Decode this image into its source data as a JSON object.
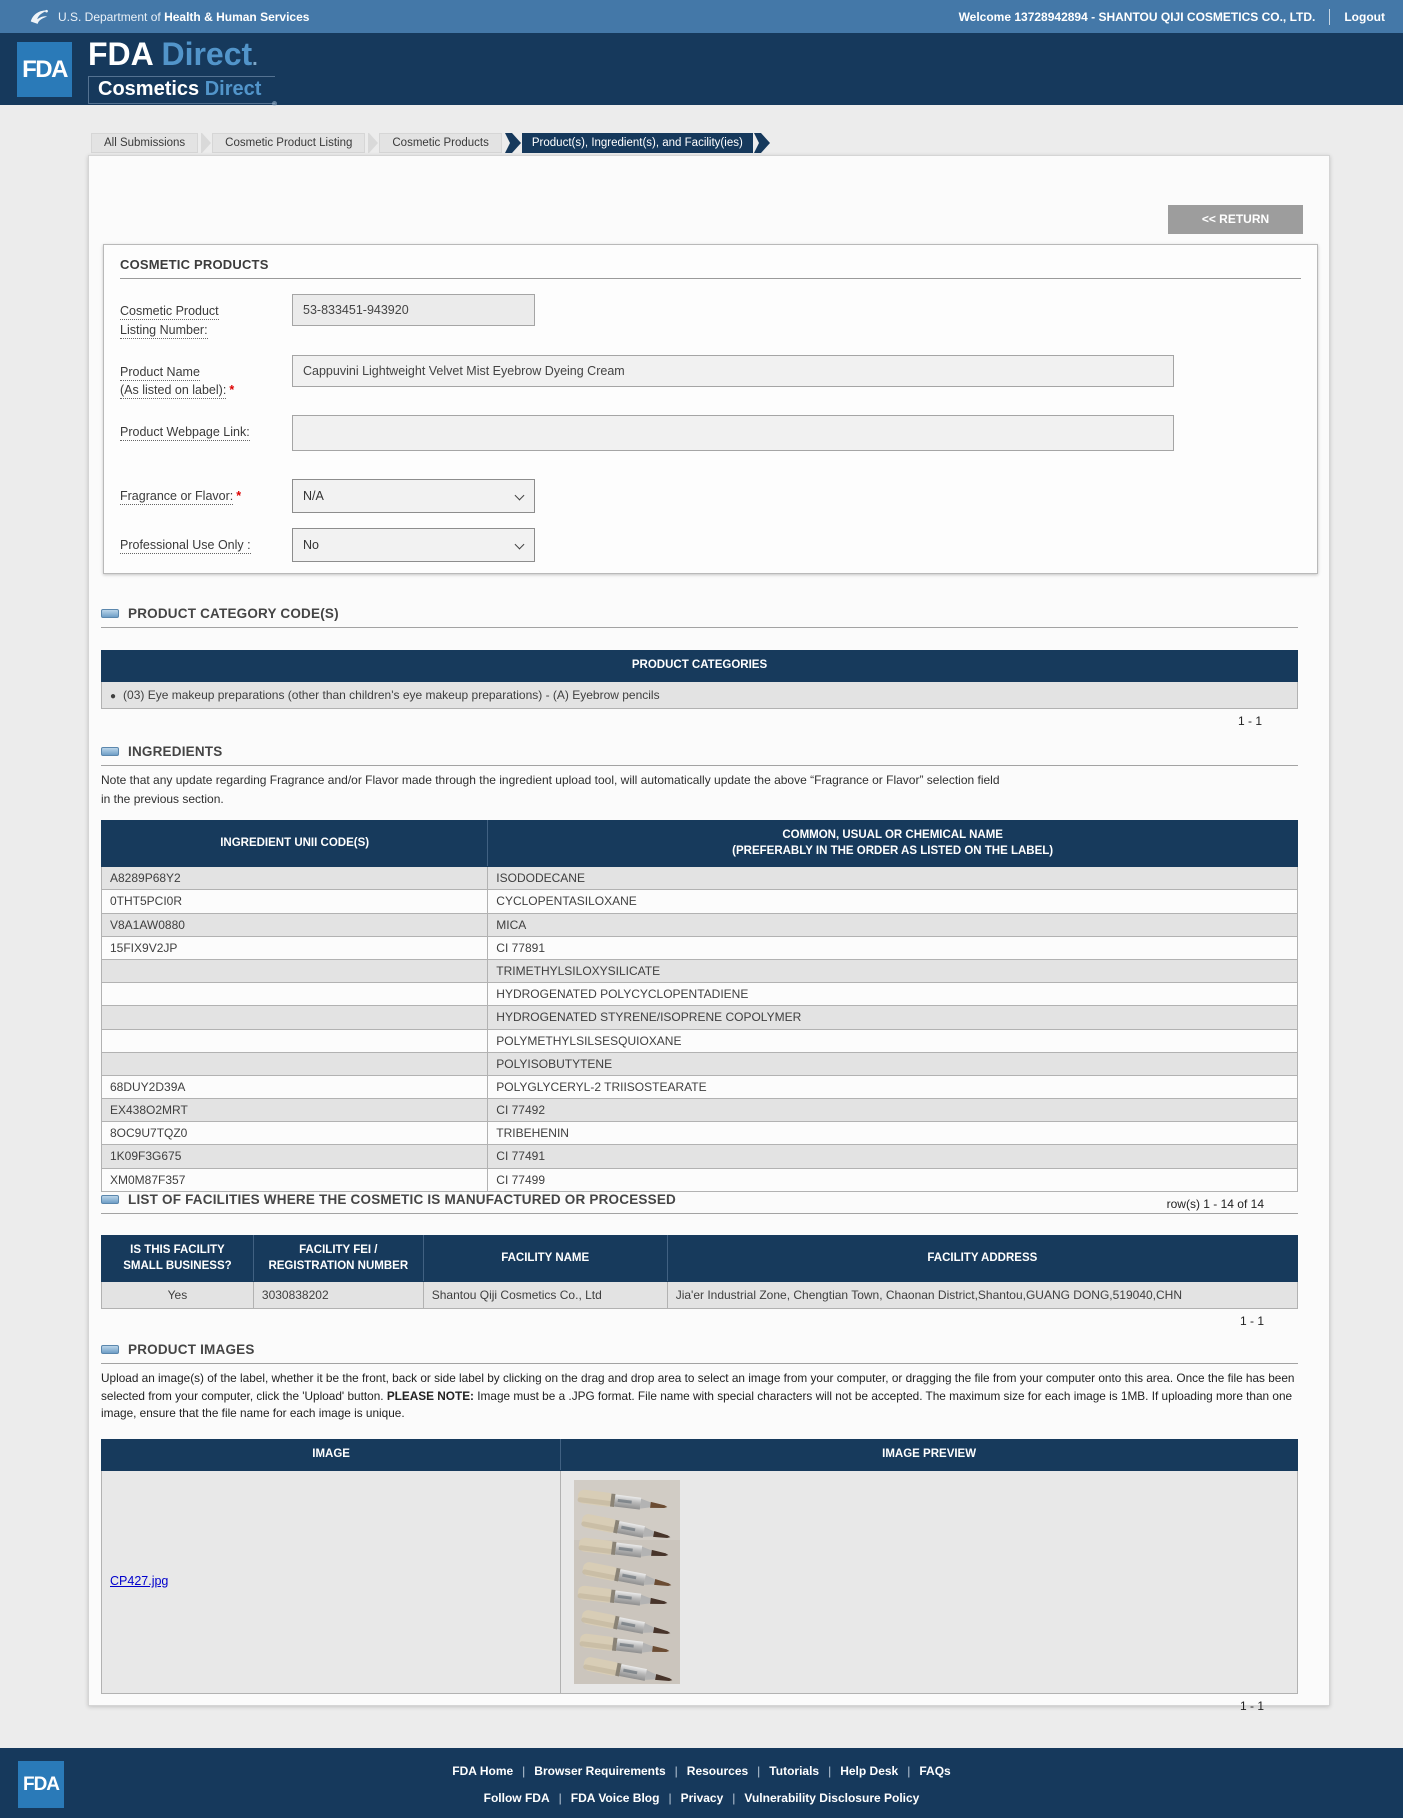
{
  "colors": {
    "topbar_blue": "#4478a8",
    "navy": "#16395c",
    "table_header_navy": "#173a5c",
    "fda_logo_blue": "#2a7ab8",
    "accent_blue": "#5295ca",
    "link_blue": "#0000cc",
    "required_red": "#dd0000",
    "button_gray": "#9d9d9d"
  },
  "topbar": {
    "dept_prefix": "U.S. Department of",
    "dept_bold": "Health & Human Services",
    "welcome": "Welcome 13728942894 - SHANTOU QIJI COSMETICS CO., LTD.",
    "logout": "Logout"
  },
  "brand": {
    "logo": "FDA",
    "title": "FDA",
    "title_accent": "Direct",
    "title_dot": ".",
    "subtitle": "Cosmetics",
    "subtitle_accent": "Direct"
  },
  "breadcrumb": {
    "tabs": [
      "All Submissions",
      "Cosmetic Product Listing",
      "Cosmetic Products"
    ],
    "active_tab": "Product(s), Ingredient(s), and Facility(ies)"
  },
  "toolbar": {
    "return_label": "<< RETURN"
  },
  "product_form": {
    "section_title": "COSMETIC PRODUCTS",
    "listing_number": {
      "label_line1": "Cosmetic Product",
      "label_line2": "Listing Number:",
      "value": "53-833451-943920"
    },
    "product_name": {
      "label_line1": "Product Name",
      "label_line2": "(As listed on label):",
      "required": "*",
      "value": "Cappuvini Lightweight Velvet Mist Eyebrow Dyeing Cream"
    },
    "webpage": {
      "label": "Product Webpage Link:",
      "value": ""
    },
    "fragrance": {
      "label": "Fragrance or Flavor:",
      "required": "*",
      "value": "N/A"
    },
    "professional": {
      "label": "Professional Use Only :",
      "value": "No"
    }
  },
  "categories": {
    "section_title": "PRODUCT CATEGORY CODE(S)",
    "table_header": "PRODUCT CATEGORIES",
    "rows": [
      "(03) Eye makeup preparations (other than children's eye makeup preparations) - (A) Eyebrow pencils"
    ],
    "pagination": "1 - 1"
  },
  "ingredients": {
    "section_title": "INGREDIENTS",
    "note_line1": "Note that any update regarding Fragrance and/or Flavor made through the ingredient upload tool, will automatically update the above “Fragrance or Flavor” selection field",
    "note_line2": "in the previous section.",
    "col1_header": "INGREDIENT UNII CODE(S)",
    "col2_header_line1": "COMMON, USUAL OR CHEMICAL NAME",
    "col2_header_line2": "(PREFERABLY IN THE ORDER AS LISTED ON THE LABEL)",
    "rows": [
      {
        "code": "A8289P68Y2",
        "name": "ISODODECANE"
      },
      {
        "code": "0THT5PCI0R",
        "name": "CYCLOPENTASILOXANE"
      },
      {
        "code": "V8A1AW0880",
        "name": "MICA"
      },
      {
        "code": "15FIX9V2JP",
        "name": "CI 77891"
      },
      {
        "code": "",
        "name": "TRIMETHYLSILOXYSILICATE"
      },
      {
        "code": "",
        "name": "HYDROGENATED POLYCYCLOPENTADIENE"
      },
      {
        "code": "",
        "name": "HYDROGENATED STYRENE/ISOPRENE COPOLYMER"
      },
      {
        "code": "",
        "name": "POLYMETHYLSILSESQUIOXANE"
      },
      {
        "code": "",
        "name": "POLYISOBUTYTENE"
      },
      {
        "code": "68DUY2D39A",
        "name": "POLYGLYCERYL-2 TRIISOSTEARATE"
      },
      {
        "code": "EX438O2MRT",
        "name": "CI 77492"
      },
      {
        "code": "8OC9U7TQZ0",
        "name": "TRIBEHENIN"
      },
      {
        "code": "1K09F3G675",
        "name": "CI 77491"
      },
      {
        "code": "XM0M87F357",
        "name": "CI 77499"
      }
    ],
    "pagination": "row(s) 1 - 14 of 14"
  },
  "facilities": {
    "section_title": "LIST OF FACILITIES WHERE THE COSMETIC IS MANUFACTURED OR PROCESSED",
    "headers": [
      "IS THIS FACILITY\nSMALL BUSINESS?",
      "FACILITY FEI /\nREGISTRATION NUMBER",
      "FACILITY NAME",
      "FACILITY ADDRESS"
    ],
    "rows": [
      {
        "small_business": "Yes",
        "fei": "3030838202",
        "name": "Shantou Qiji Cosmetics Co., Ltd",
        "address": "Jia'er Industrial Zone, Chengtian Town, Chaonan District,Shantou,GUANG DONG,519040,CHN"
      }
    ],
    "pagination": "1 - 1"
  },
  "images": {
    "section_title": "PRODUCT IMAGES",
    "desc_part1": "Upload an image(s) of the label, whether it be the front, back or side label by clicking on the drag and drop area to select an image from your computer, or dragging the file from your computer onto this area. Once the file has been selected from your computer, click the 'Upload' button. ",
    "desc_bold": "PLEASE NOTE:",
    "desc_part2": " Image must be a .JPG format. File name with special characters will not be accepted. The maximum size for each image is 1MB. If uploading more than one image, ensure that the file name for each image is unique.",
    "col1_header": "IMAGE",
    "col2_header": "IMAGE PREVIEW",
    "rows": [
      {
        "filename": "CP427.jpg"
      }
    ],
    "pagination": "1 - 1"
  },
  "footer": {
    "logo": "FDA",
    "links_row1": [
      "FDA Home",
      "Browser Requirements",
      "Resources",
      "Tutorials",
      "Help Desk",
      "FAQs"
    ],
    "links_row2": [
      "Follow FDA",
      "FDA Voice Blog",
      "Privacy",
      "Vulnerability Disclosure Policy"
    ]
  }
}
